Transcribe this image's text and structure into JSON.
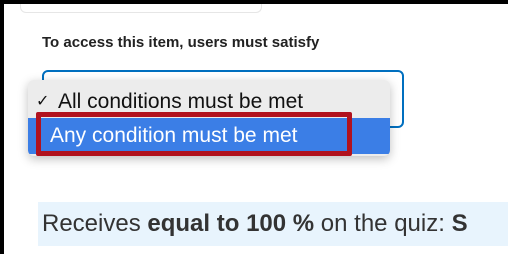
{
  "section": {
    "label": "To access this item, users must satisfy"
  },
  "dropdown": {
    "options": [
      {
        "label": "All conditions must be met",
        "checked": true
      },
      {
        "label": "Any condition must be met",
        "highlighted": true
      }
    ],
    "check_mark": "✓"
  },
  "rule": {
    "prefix": "Receives",
    "condition": "equal to 100 %",
    "middle": "on the quiz:",
    "quiz_name": "S"
  },
  "colors": {
    "focus_border": "#006fbf",
    "highlight_option": "#3b7ee6",
    "annotation_box": "#b1121e",
    "rule_background": "#e8f4fd"
  }
}
